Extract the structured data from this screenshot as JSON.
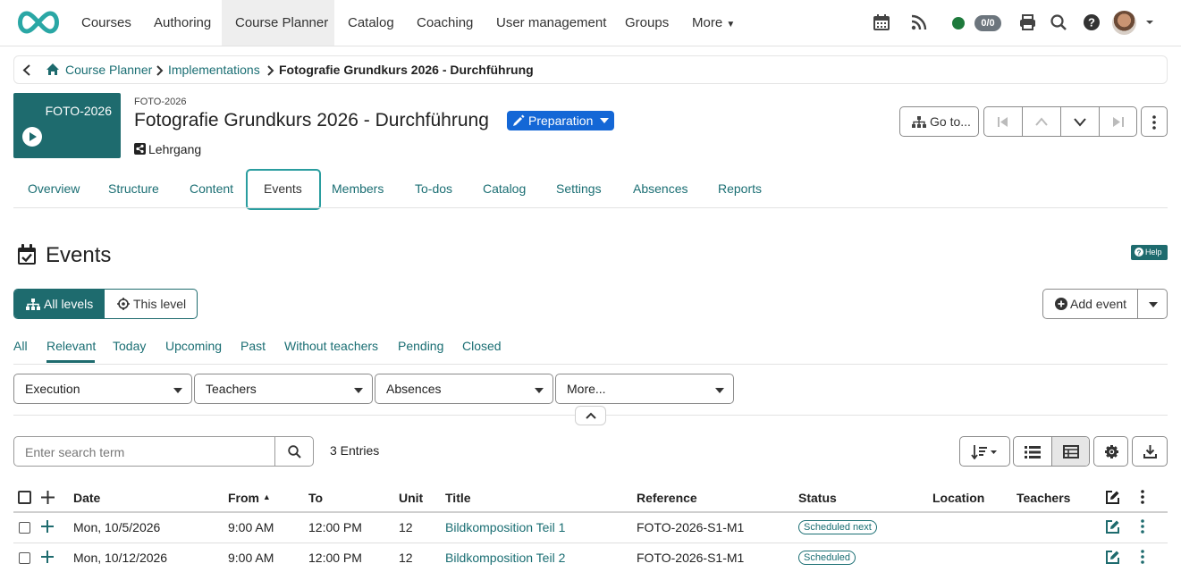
{
  "nav": {
    "items": [
      "Courses",
      "Authoring",
      "Course Planner",
      "Catalog",
      "Coaching",
      "User management",
      "Groups",
      "More"
    ],
    "active": "Course Planner",
    "counter_badge": "0/0",
    "online_color": "#1e7a3c"
  },
  "breadcrumb": {
    "items": [
      "Course Planner",
      "Implementations"
    ],
    "current": "Fotografie Grundkurs 2026 - Durchführung"
  },
  "header": {
    "thumb_title": "FOTO-2026",
    "external_ref": "FOTO-2026",
    "title": "Fotografie Grundkurs 2026 - Durchführung",
    "status": "Preparation",
    "type": "Lehrgang",
    "goto_label": "Go to..."
  },
  "tabs": [
    "Overview",
    "Structure",
    "Content",
    "Events",
    "Members",
    "To-dos",
    "Catalog",
    "Settings",
    "Absences",
    "Reports"
  ],
  "active_tab": "Events",
  "section": {
    "title": "Events",
    "help_label": "Help",
    "levels": [
      "All levels",
      "This level"
    ],
    "add_event_label": "Add event"
  },
  "filters": {
    "items": [
      "All",
      "Relevant",
      "Today",
      "Upcoming",
      "Past",
      "Without teachers",
      "Pending",
      "Closed"
    ],
    "active": "Relevant"
  },
  "dropdowns": [
    "Execution",
    "Teachers",
    "Absences",
    "More..."
  ],
  "search": {
    "placeholder": "Enter search term",
    "entries_label": "3 Entries"
  },
  "table": {
    "columns": [
      "Date",
      "From",
      "To",
      "Unit",
      "Title",
      "Reference",
      "Status",
      "Location",
      "Teachers"
    ],
    "rows": [
      {
        "date": "Mon, 10/5/2026",
        "from": "9:00 AM",
        "to": "12:00 PM",
        "unit": "12",
        "title": "Bildkomposition Teil 1",
        "reference": "FOTO-2026-S1-M1",
        "status": "Scheduled next",
        "location": "",
        "teachers": ""
      },
      {
        "date": "Mon, 10/12/2026",
        "from": "9:00 AM",
        "to": "12:00 PM",
        "unit": "12",
        "title": "Bildkomposition Teil 2",
        "reference": "FOTO-2026-S1-M1",
        "status": "Scheduled",
        "location": "",
        "teachers": ""
      }
    ]
  },
  "colors": {
    "brand": "#1e6b6e",
    "link": "#1a6e73",
    "status_primary": "#1467d6"
  }
}
